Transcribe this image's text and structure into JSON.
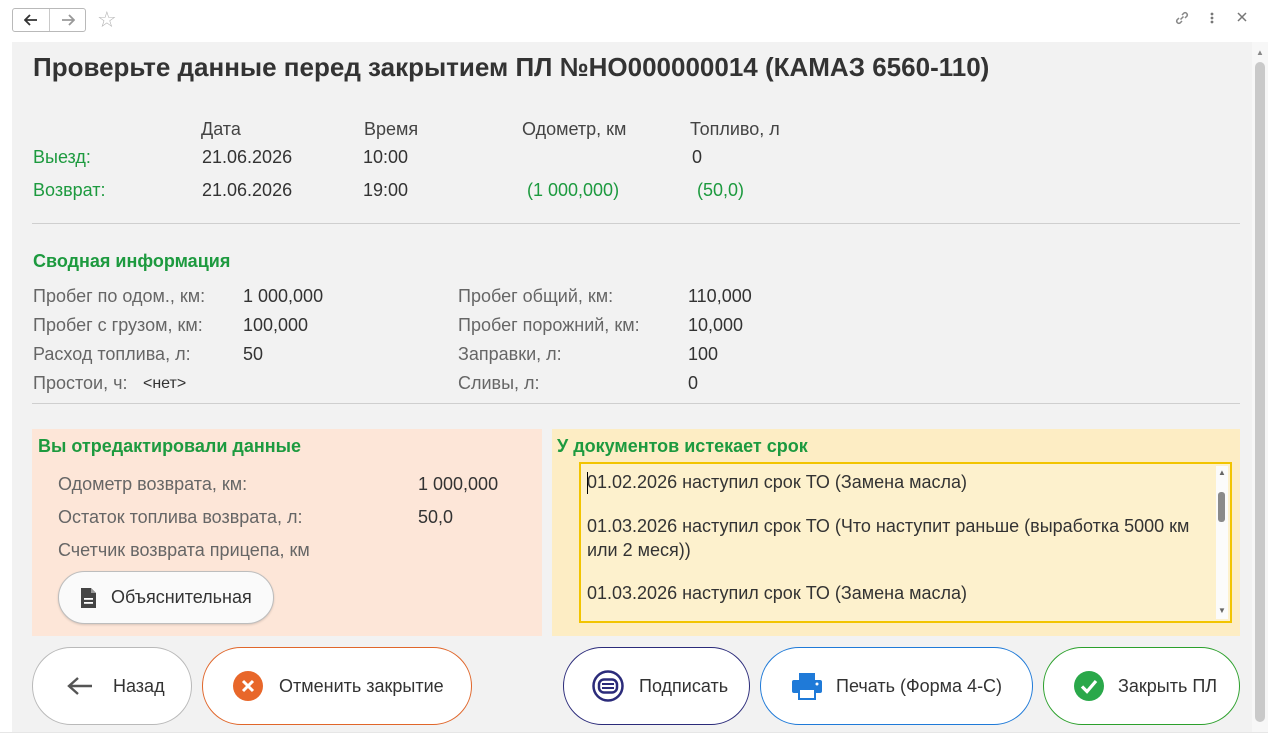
{
  "topbar": {
    "back_icon": "arrow-left-icon",
    "forward_icon": "arrow-right-icon",
    "favorite_icon": "star-icon",
    "link_icon": "link-icon",
    "more_icon": "kebab-menu-icon",
    "close_icon": "close-icon"
  },
  "title": "Проверьте данные перед закрытием ПЛ №НО000000014 (КАМАЗ 6560-110)",
  "trip": {
    "headers": {
      "date": "Дата",
      "time": "Время",
      "odometer": "Одометр, км",
      "fuel": "Топливо, л"
    },
    "departure": {
      "label": "Выезд:",
      "date": "21.06.2026",
      "time": "10:00",
      "odometer": "",
      "fuel": "0"
    },
    "return": {
      "label": "Возврат:",
      "date": "21.06.2026",
      "time": "19:00",
      "odometer": "(1 000,000)",
      "fuel": "(50,0)"
    }
  },
  "summary": {
    "title": "Сводная информация",
    "left": [
      {
        "label": "Пробег по одом., км:",
        "value": "1 000,000"
      },
      {
        "label": "Пробег с грузом, км:",
        "value": "100,000"
      },
      {
        "label": "Расход топлива, л:",
        "value": "50"
      },
      {
        "label": "Простои, ч:",
        "value": "<нет>"
      }
    ],
    "right": [
      {
        "label": "Пробег общий, км:",
        "value": "110,000"
      },
      {
        "label": "Пробег порожний, км:",
        "value": "10,000"
      },
      {
        "label": "Заправки, л:",
        "value": "100"
      },
      {
        "label": "Сливы, л:",
        "value": "0"
      }
    ]
  },
  "edited": {
    "title": "Вы отредактировали данные",
    "rows": [
      {
        "label": "Одометр возврата, км:",
        "value": "1 000,000"
      },
      {
        "label": "Остаток топлива возврата, л:",
        "value": "50,0"
      },
      {
        "label": "Счетчик возврата прицепа, км",
        "value": ""
      }
    ],
    "explanation_button": "Объяснительная",
    "explanation_icon": "document-icon"
  },
  "expiring": {
    "title": "У документов истекает срок",
    "items": [
      "01.02.2026 наступил срок ТО (Замена масла)",
      "01.03.2026 наступил срок ТО (Что наступит раньше (выработка 5000 км или 2 меся))",
      "01.03.2026 наступил срок ТО (Замена масла)"
    ]
  },
  "buttons": {
    "back": "Назад",
    "cancel_closing": "Отменить закрытие",
    "sign": "Подписать",
    "print": "Печать  (Форма 4-С)",
    "close_pl": "Закрыть ПЛ"
  },
  "colors": {
    "accent_green": "#1d9a3f",
    "cancel_orange": "#e0662a",
    "sign_navy": "#2b2b7a",
    "print_blue": "#1f7ad8",
    "edited_bg": "#fde6d8",
    "expiring_bg": "#fdedc4",
    "expiring_border": "#f2c400"
  }
}
